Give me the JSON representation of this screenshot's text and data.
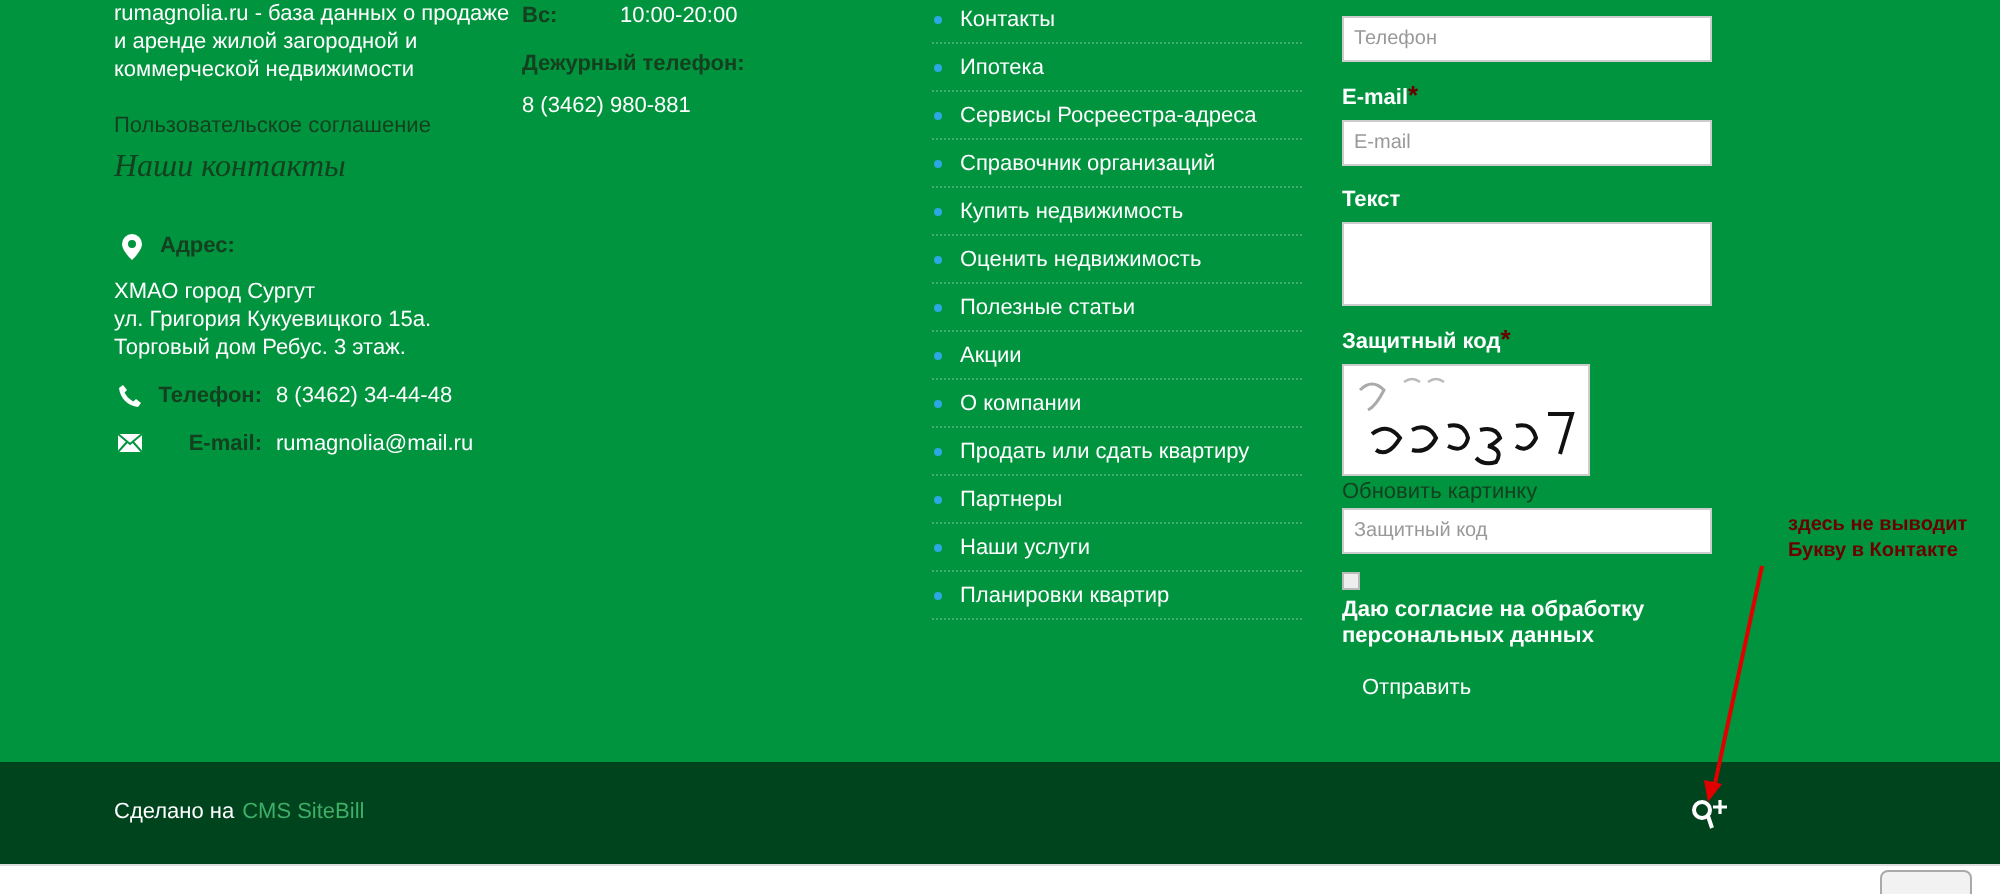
{
  "about": {
    "description": "rumagnolia.ru - база данных о продаже и аренде жилой загородной и коммерческой недвижимости",
    "agreement_link": "Пользовательское соглашение",
    "contacts_title": "Наши контакты",
    "contacts": [
      {
        "kind": "address",
        "label": "Адрес:",
        "value": "ХМАО город Сургут\nул. Григория Кукуевицкого 15а.\nТорговый дом Ребус. 3 этаж."
      },
      {
        "kind": "phone",
        "label": "Телефон:",
        "value": "8 (3462) 34-44-48"
      },
      {
        "kind": "email",
        "label": "E-mail:",
        "value": "rumagnolia@mail.ru"
      }
    ]
  },
  "schedule": {
    "day": "Вс:",
    "hours": "10:00-20:00",
    "duty_phone_label": "Дежурный телефон:",
    "duty_phone": "8 (3462) 980-881"
  },
  "menu": [
    "Контакты",
    "Ипотека",
    "Сервисы Росреестра-адреса",
    "Справочник организаций",
    "Купить недвижимость",
    "Оценить недвижимость",
    "Полезные статьи",
    "Акции",
    "О компании",
    "Продать или сдать квартиру",
    "Партнеры",
    "Наши услуги",
    "Планировки квартир"
  ],
  "form": {
    "fields": [
      {
        "kind": "input",
        "placeholder": "Телефон"
      },
      {
        "kind": "input",
        "label": "E-mail",
        "mark": "*",
        "placeholder": "E-mail"
      },
      {
        "kind": "textarea",
        "label": "Текст"
      },
      {
        "kind": "captcha",
        "label": "Защитный код",
        "mark": "*",
        "refresh": "Обновить картинку"
      },
      {
        "kind": "input",
        "placeholder": "Защитный код"
      },
      {
        "kind": "checkbox",
        "checked": false,
        "label": "Даю согласие на обработку персональных данных"
      }
    ],
    "submit": "Отправить"
  },
  "annotation": {
    "text": "здесь не выводит\nБукву в Контакте"
  },
  "footer": {
    "made_with": "Сделано на",
    "cms_link": "CMS SiteBill"
  }
}
